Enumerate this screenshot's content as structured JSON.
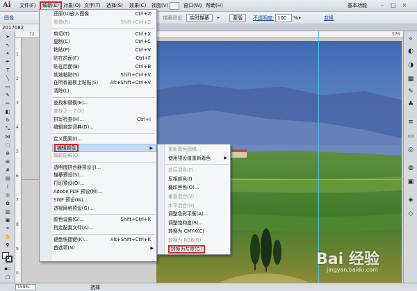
{
  "menubar": {
    "logo": "Ai",
    "items": [
      "文件(F)",
      "编辑(E)",
      "对象(O)",
      "文字(T)",
      "选择(S)",
      "效果(C)",
      "视图(V)",
      "窗口(W)",
      "帮助(H)"
    ],
    "workspace": "基本功能",
    "win_min": "–",
    "win_max": "□",
    "win_close": "×"
  },
  "controlbar": {
    "left_label": "图像",
    "trace_button": "实时描摹",
    "mask_button": "蒙版",
    "opacity_label": "不透明度:",
    "opacity_value": "100",
    "opacity_unit": "%",
    "arrow": "▸",
    "transform": "变换",
    "mask_hint": "描摹预设"
  },
  "doc_tab": "2017082",
  "rulers": {
    "top_72": "72",
    "top_576": "576",
    "left_ticks": [
      "1",
      "2",
      "3",
      "4",
      "5",
      "6",
      "7",
      "8",
      "9",
      "0"
    ]
  },
  "edit_menu": {
    "items": [
      {
        "label": "还原(U)嵌入图像",
        "shortcut": "Ctrl+Z",
        "disabled": false
      },
      {
        "label": "重做(R)",
        "shortcut": "Shift+Ctrl+Z",
        "disabled": true
      },
      {
        "sep": true
      },
      {
        "label": "剪切(T)",
        "shortcut": "Ctrl+X",
        "disabled": false
      },
      {
        "label": "复制(C)",
        "shortcut": "Ctrl+C",
        "disabled": false
      },
      {
        "label": "粘贴(P)",
        "shortcut": "Ctrl+V",
        "disabled": false
      },
      {
        "label": "贴在前面(F)",
        "shortcut": "Ctrl+F",
        "disabled": false
      },
      {
        "label": "贴在后面(B)",
        "shortcut": "Ctrl+B",
        "disabled": false
      },
      {
        "label": "就地粘贴(S)",
        "shortcut": "Shift+Ctrl+V",
        "disabled": false
      },
      {
        "label": "在所有画板上粘贴(S)",
        "shortcut": "Alt+Shift+Ctrl+V",
        "disabled": false
      },
      {
        "label": "清除(L)",
        "shortcut": "",
        "disabled": false
      },
      {
        "sep": true
      },
      {
        "label": "查找和替换(E)...",
        "shortcut": "",
        "disabled": false
      },
      {
        "label": "查找下一个(X)",
        "shortcut": "",
        "disabled": true
      },
      {
        "label": "拼写检查(H)...",
        "shortcut": "Ctrl+I",
        "disabled": false
      },
      {
        "label": "编辑自定词典(D)...",
        "shortcut": "",
        "disabled": false
      },
      {
        "sep": true
      },
      {
        "label": "定义图案(I)...",
        "shortcut": "",
        "disabled": false
      },
      {
        "label": "编辑颜色",
        "shortcut": "",
        "disabled": false,
        "submenu": true,
        "highlight": true
      },
      {
        "label": "编辑原稿(O)",
        "shortcut": "",
        "disabled": true
      },
      {
        "sep": true
      },
      {
        "label": "透明度拼合器预设(J)...",
        "shortcut": "",
        "disabled": false
      },
      {
        "label": "描摹预设(S)...",
        "shortcut": "",
        "disabled": false
      },
      {
        "label": "打印预设(Q)...",
        "shortcut": "",
        "disabled": false
      },
      {
        "label": "Adobe PDF 预设(M)...",
        "shortcut": "",
        "disabled": false
      },
      {
        "label": "SWF 预设(W)...",
        "shortcut": "",
        "disabled": false
      },
      {
        "label": "透视网格预设(G)...",
        "shortcut": "",
        "disabled": false
      },
      {
        "sep": true
      },
      {
        "label": "颜色设置(G)...",
        "shortcut": "Shift+Ctrl+K",
        "disabled": false
      },
      {
        "label": "指定配置文件(A)...",
        "shortcut": "",
        "disabled": false
      },
      {
        "sep": true
      },
      {
        "label": "键盘快捷键(K)...",
        "shortcut": "Alt+Shift+Ctrl+K",
        "disabled": false
      },
      {
        "label": "首选项(N)",
        "shortcut": "",
        "disabled": false,
        "submenu": true
      }
    ]
  },
  "sub_menu": {
    "items": [
      {
        "label": "重新着色图稿...",
        "disabled": true
      },
      {
        "label": "使用预设值重新着色",
        "disabled": false,
        "submenu": true
      },
      {
        "sep": true
      },
      {
        "label": "前后混合(F)",
        "disabled": true
      },
      {
        "label": "反相颜色(I)",
        "disabled": false
      },
      {
        "label": "叠印黑色(O)...",
        "disabled": false
      },
      {
        "label": "垂直混合(V)",
        "disabled": true
      },
      {
        "label": "水平混合(H)",
        "disabled": true
      },
      {
        "label": "调整色彩平衡(A)...",
        "disabled": false
      },
      {
        "label": "调整饱和度(S)...",
        "disabled": false
      },
      {
        "label": "转换为 CMYK(C)",
        "disabled": false
      },
      {
        "label": "转换为 RGB(R)",
        "disabled": true
      },
      {
        "label": "转换为灰度(G)",
        "disabled": false,
        "boxed": true
      }
    ]
  },
  "status": {
    "zoom": "150%",
    "tool": "选择"
  },
  "watermark": {
    "brand": "Bai 经验",
    "site": "jingyan.baidu.com"
  },
  "colors": {
    "highlight_box": "#e02020",
    "menu_hover": "#c5dcf5",
    "guide": "#3ec6e8"
  }
}
